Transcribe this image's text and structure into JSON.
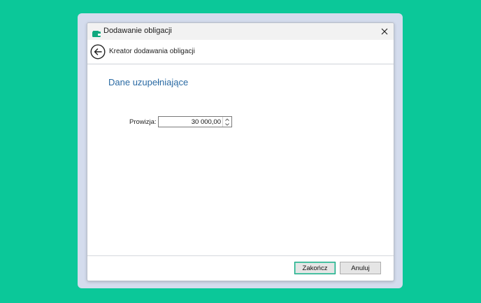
{
  "window": {
    "title": "Dodawanie obligacji",
    "icon": "wallet-icon"
  },
  "wizard": {
    "title": "Kreator dodawania obligacji",
    "back_icon": "back-arrow-icon"
  },
  "section": {
    "title": "Dane uzupełniające"
  },
  "form": {
    "commission": {
      "label": "Prowizja:",
      "value": "30 000,00"
    }
  },
  "buttons": {
    "finish": "Zakończ",
    "cancel": "Anuluj"
  },
  "colors": {
    "background": "#0bc899",
    "accent": "#2a6aa3",
    "focus_border": "#10a37f"
  }
}
